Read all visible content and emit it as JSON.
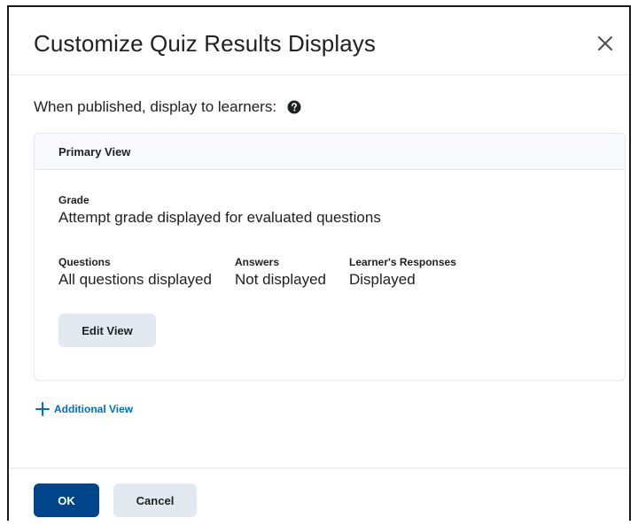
{
  "dialog": {
    "title": "Customize Quiz Results Displays",
    "close_icon": "close-icon"
  },
  "intro": {
    "text": "When published, display to learners:",
    "help_icon": "help-icon"
  },
  "primary_view": {
    "heading": "Primary View",
    "grade": {
      "label": "Grade",
      "value": "Attempt grade displayed for evaluated questions"
    },
    "questions": {
      "label": "Questions",
      "value": "All questions displayed"
    },
    "answers": {
      "label": "Answers",
      "value": "Not displayed"
    },
    "responses": {
      "label": "Learner's Responses",
      "value": "Displayed"
    },
    "edit_label": "Edit View"
  },
  "additional_view": {
    "label": "Additional View",
    "icon": "plus-icon"
  },
  "footer": {
    "ok_label": "OK",
    "cancel_label": "Cancel"
  },
  "colors": {
    "primary": "#004489",
    "link": "#006fbf",
    "secondary_button": "#e3e9f1",
    "card_header": "#f7f9fc"
  }
}
